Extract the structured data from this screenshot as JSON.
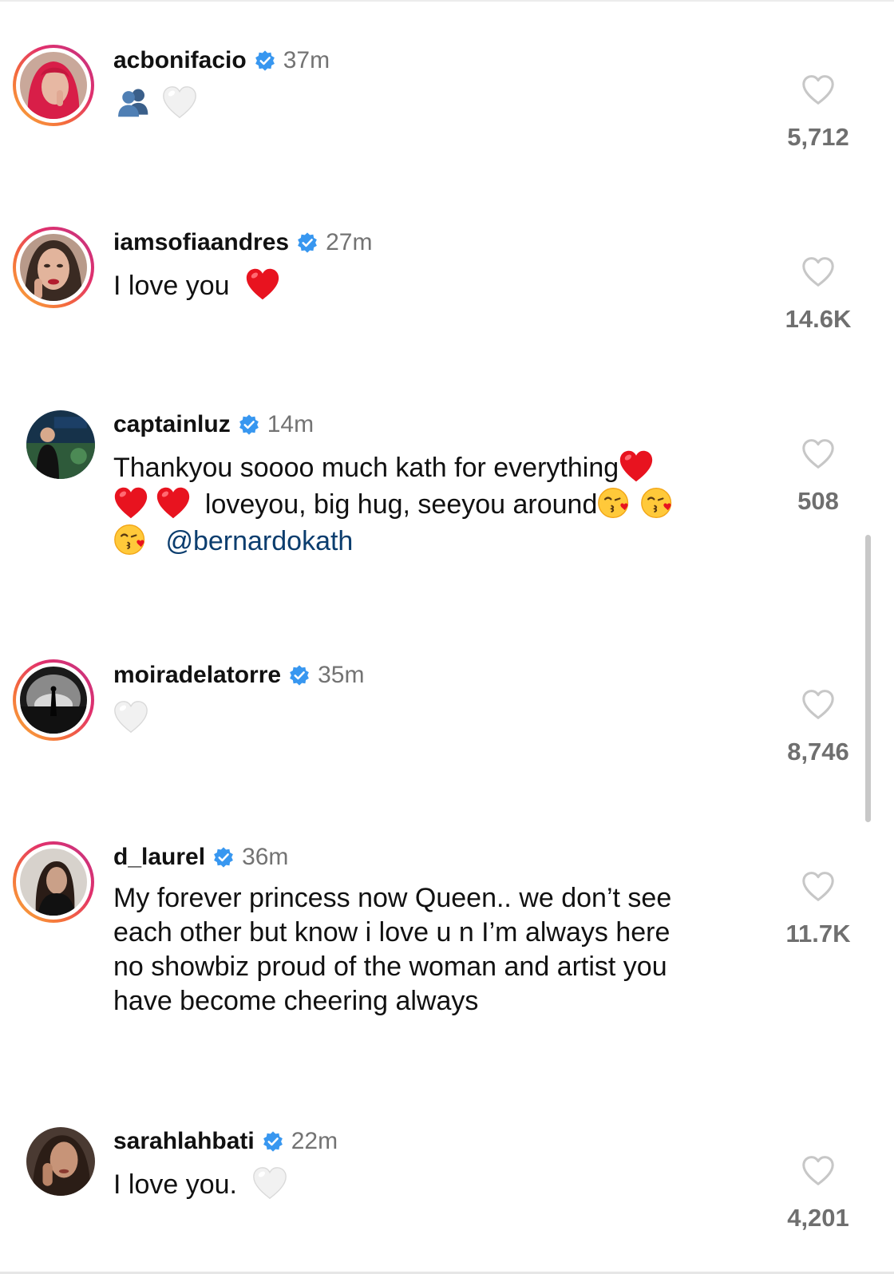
{
  "comments": [
    {
      "username": "acbonifacio",
      "time": "37m",
      "text_before": "",
      "text_after": "",
      "mention": "",
      "emojis": [
        "busts-in-silhouette-emoji",
        "white-heart-emoji"
      ],
      "likes": "5,712"
    },
    {
      "username": "iamsofiaandres",
      "time": "27m",
      "text_before": "I love you",
      "emojis": [
        "red-heart-emoji"
      ],
      "likes": "14.6K"
    },
    {
      "username": "captainluz",
      "time": "14m",
      "text_line1": "Thankyou soooo much kath for everything",
      "text_line2": "loveyou, big hug, seeyou around",
      "mention": "@bernardokath",
      "emojis": [
        "red-heart-emoji",
        "red-heart-emoji",
        "red-heart-emoji",
        "kissing-face-emoji",
        "kissing-face-emoji",
        "kissing-face-emoji"
      ],
      "likes": "508"
    },
    {
      "username": "moiradelatorre",
      "time": "35m",
      "emojis": [
        "white-heart-emoji"
      ],
      "likes": "8,746"
    },
    {
      "username": "d_laurel",
      "time": "36m",
      "text_lines": [
        "My forever princess now Queen.. we don’t see",
        "each other but know i love u n I’m always here",
        "no showbiz proud of the woman and artist you",
        "have become cheering always"
      ],
      "likes": "11.7K"
    },
    {
      "username": "sarahlahbati",
      "time": "22m",
      "text_before": "I love you.",
      "emojis": [
        "white-heart-emoji"
      ],
      "likes": "4,201"
    }
  ],
  "icons": {
    "verified": "verified-badge-icon",
    "like": "heart-outline-icon"
  },
  "colors": {
    "verified_blue": "#3897f0",
    "mention_blue": "#0b3d6e",
    "time_gray": "#737373",
    "count_gray": "#6f6f6f",
    "heart_red": "#e8131f"
  }
}
